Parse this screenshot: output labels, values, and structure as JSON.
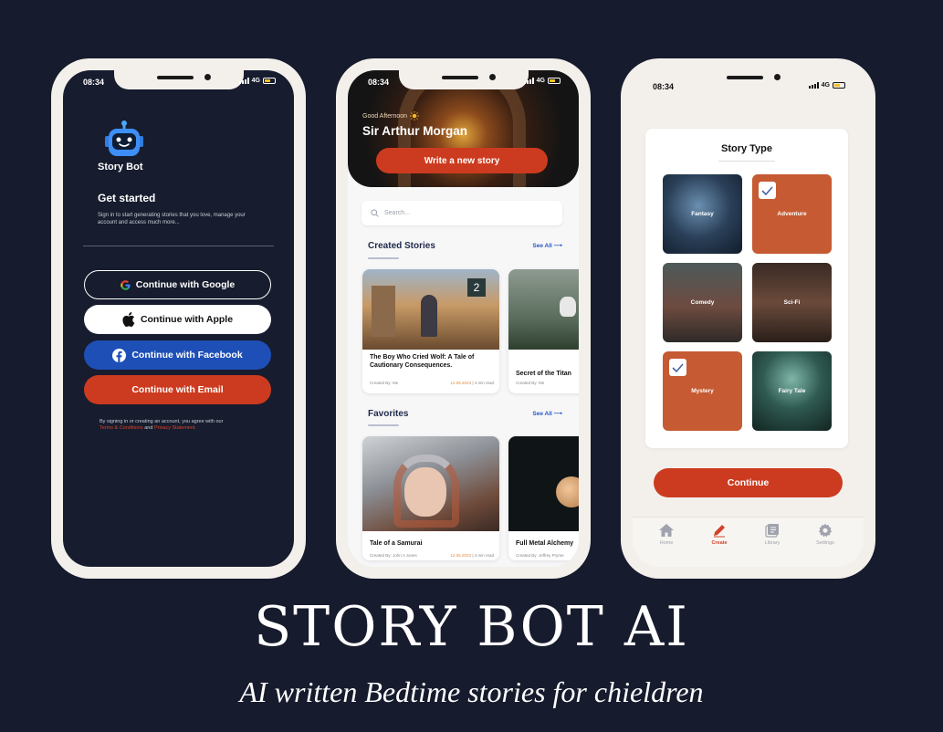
{
  "status_bar": {
    "time": "08:34",
    "network": "4G"
  },
  "login": {
    "brand": "Story Bot",
    "title": "Get started",
    "description": "Sign in to start generating stories that you love, manage your account and access much more...",
    "google_btn": "Continue with Google",
    "apple_btn": "Continue with Apple",
    "facebook_btn": "Continue with Facebook",
    "email_btn": "Continue with Email",
    "legal_prefix": "By signing in or creating an account, you agree with our",
    "terms_link": "Terms & Conditions",
    "legal_and": "and",
    "privacy_link": "Privacy Statement."
  },
  "home": {
    "greeting": "Good Afternoon",
    "user_name": "Sir Arthur Morgan",
    "write_btn": "Write  a new story",
    "search_placeholder": "Search...",
    "created_section": "Created Stories",
    "favorites_section": "Favorites",
    "see_all": "See All",
    "created_stories": [
      {
        "title": "The Boy Who Cried Wolf: A Tale of Cautionary Consequences.",
        "author": "Created By: Me",
        "date": "12.05.2023",
        "read": "| 4 min read"
      },
      {
        "title": "Secret of the Titan",
        "author": "Created By: Me"
      }
    ],
    "favorites": [
      {
        "title": "Tale of a Samurai",
        "author": "Created By: John A Jones",
        "date": "12.05.2023",
        "read": "| 4 min read"
      },
      {
        "title": "Full Metal Alchemy",
        "author": "Created By: Jeffrey Pryme"
      }
    ]
  },
  "story_type": {
    "title": "Story Type",
    "types": [
      {
        "label": "Fantasy",
        "selected": false
      },
      {
        "label": "Adventure",
        "selected": true
      },
      {
        "label": "Comedy",
        "selected": false
      },
      {
        "label": "Sci-Fi",
        "selected": false
      },
      {
        "label": "Mystery",
        "selected": true
      },
      {
        "label": "Fairy Tale",
        "selected": false
      }
    ],
    "continue_btn": "Continue",
    "tabs": [
      {
        "label": "Home",
        "icon": "home-icon"
      },
      {
        "label": "Create",
        "icon": "pencil-icon"
      },
      {
        "label": "Library",
        "icon": "library-icon"
      },
      {
        "label": "Settings",
        "icon": "gear-icon"
      }
    ],
    "active_tab": "Create"
  },
  "headline": "STORY BOT AI",
  "tagline": "AI written Bedtime stories for chieldren",
  "colors": {
    "background": "#161b2d",
    "accent": "#cc3b1f",
    "facebook": "#1d4fb7",
    "link": "#2856c6"
  }
}
